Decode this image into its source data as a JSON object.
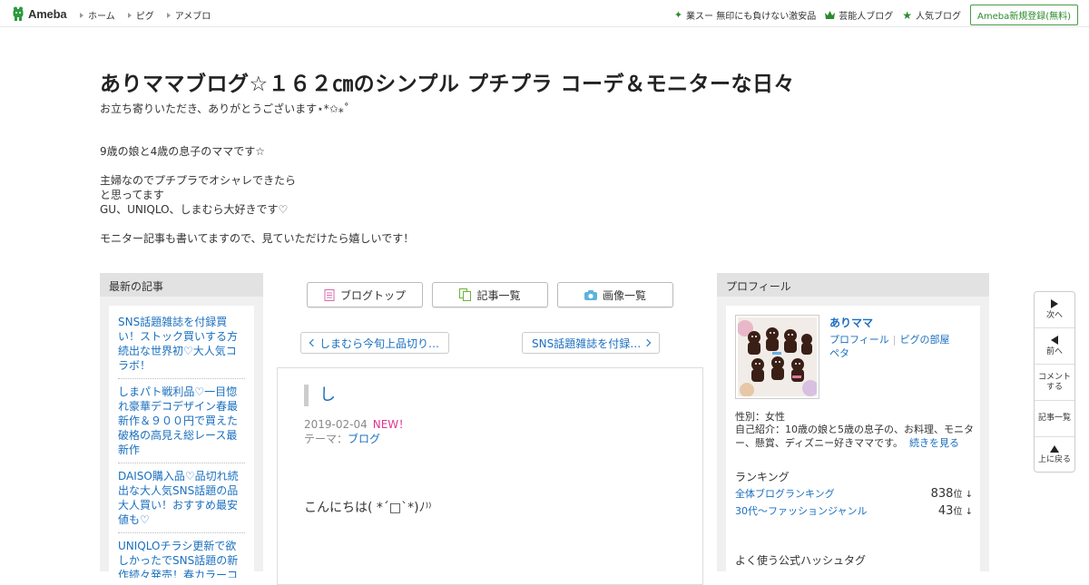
{
  "topbar": {
    "logo_text": "Ameba",
    "nav": [
      "ホーム",
      "ピグ",
      "アメブロ"
    ],
    "right_links": [
      {
        "label": "業スー 無印にも負けない激安品",
        "icon": "sparkle-icon"
      },
      {
        "label": "芸能人ブログ",
        "icon": "crown-icon"
      },
      {
        "label": "人気ブログ",
        "icon": "star-icon"
      }
    ],
    "register_label": "Ameba新規登録(無料)"
  },
  "blog": {
    "title": "ありママブログ☆１６２㎝のシンプル プチプラ コーデ＆モニターな日々",
    "subtitle": "お立ち寄りいただき、ありがとうございます⋆*✩⁎˚",
    "description": [
      "9歳の娘と4歳の息子のママです☆",
      "",
      "主婦なのでプチプラでオシャレできたら",
      "と思ってます",
      "GU、UNIQLO、しまむら大好きです♡",
      "",
      "モニター記事も書いてますので、見ていただけたら嬉しいです！"
    ]
  },
  "recent": {
    "heading": "最新の記事",
    "items": [
      "SNS話題雑誌を付録買い！ストック買いする方続出な世界初♡大人気コラボ！",
      "しまパト戦利品♡一目惚れ豪華デコデザイン春最新作＆９００円で買えた破格の高見え総レース最新作",
      "DAISO購入品♡品切れ続出な大人気SNS話題の品大人買い！おすすめ最安値も♡",
      "UNIQLOチラシ更新で欲しかったでSNS話題の新作続々発売！春カラーコーデ最新作♡"
    ]
  },
  "center": {
    "buttons": [
      {
        "label": "ブログトップ",
        "icon": "document-icon"
      },
      {
        "label": "記事一覧",
        "icon": "copy-icon"
      },
      {
        "label": "画像一覧",
        "icon": "camera-icon"
      }
    ],
    "prev_label": "しまむら今旬上品切り…",
    "next_label": "SNS話題雑誌を付録…",
    "article": {
      "title": "し",
      "date": "2019-02-04",
      "new_badge": "NEW！",
      "theme_label": "テーマ：",
      "theme": "ブログ",
      "body": "こんにちは( *´□`*)ﾉ⁾⁾"
    }
  },
  "profile": {
    "heading": "プロフィール",
    "name": "ありママ",
    "links": [
      "プロフィール",
      "ピグの部屋",
      "ペタ"
    ],
    "gender": "性別：女性",
    "intro": "自己紹介：10歳の娘と5歳の息子の、お料理、モニター、懸賞、ディズニー好きママです。",
    "more": "続きを見る",
    "ranking_heading": "ランキング",
    "rankings": [
      {
        "label": "全体ブログランキング",
        "value": "838",
        "unit": "位 ↓"
      },
      {
        "label": "30代〜ファッションジャンル",
        "value": "43",
        "unit": "位 ↓"
      }
    ],
    "hashtag_heading": "よく使う公式ハッシュタグ"
  },
  "float_nav": [
    {
      "label": "次へ",
      "icon": "next-icon"
    },
    {
      "label": "前へ",
      "icon": "prev-icon"
    },
    {
      "label": "コメントする",
      "icon": ""
    },
    {
      "label": "記事一覧",
      "icon": ""
    },
    {
      "label": "上に戻る",
      "icon": "up-icon"
    }
  ],
  "colors": {
    "link": "#1a6fbf",
    "new": "#e0338f",
    "brand": "#2d8a2d"
  }
}
